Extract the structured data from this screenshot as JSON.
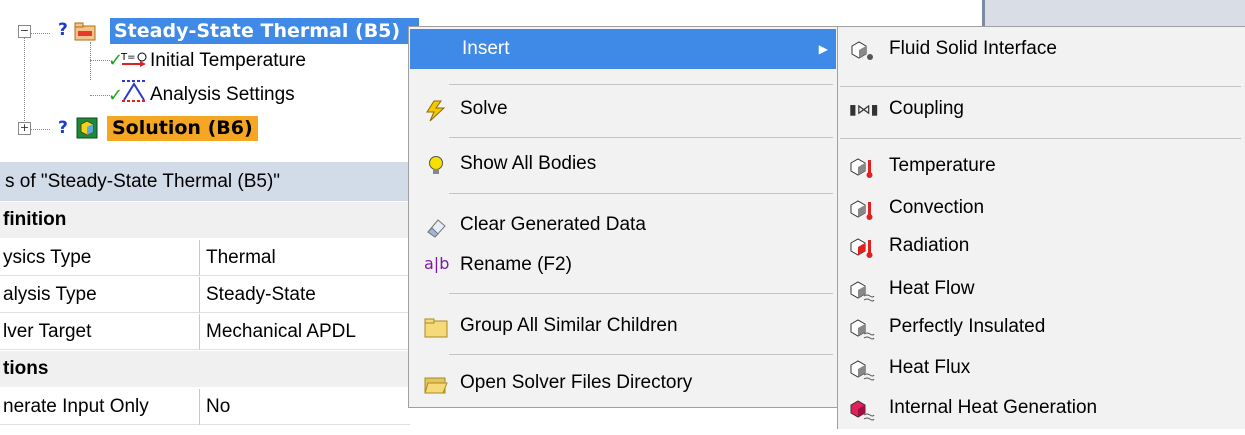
{
  "tree": {
    "analysis_label": "Steady-State Thermal (B5)",
    "children": [
      {
        "label": "Initial Temperature",
        "icon": "temperature-icon"
      },
      {
        "label": "Analysis Settings",
        "icon": "analysis-settings-icon"
      }
    ],
    "solution_label": "Solution (B6)"
  },
  "details": {
    "header": "s of \"Steady-State Thermal (B5)\"",
    "sections": [
      {
        "title": "finition",
        "rows": [
          {
            "name": "ysics Type",
            "value": "Thermal"
          },
          {
            "name": "alysis Type",
            "value": "Steady-State"
          },
          {
            "name": "lver Target",
            "value": "Mechanical APDL"
          }
        ]
      },
      {
        "title": "tions",
        "rows": [
          {
            "name": "nerate Input Only",
            "value": "No"
          }
        ]
      }
    ]
  },
  "context_menu": {
    "items": [
      {
        "label": "Insert",
        "icon": "none",
        "highlighted": true,
        "has_submenu": true
      },
      {
        "label": "Solve",
        "icon": "lightning-bolt-icon"
      },
      {
        "label": "Show All Bodies",
        "icon": "lightbulb-icon"
      },
      {
        "label": "Clear Generated Data",
        "icon": "eraser-icon"
      },
      {
        "label": "Rename (F2)",
        "icon": "rename-icon"
      },
      {
        "label": "Group All Similar Children",
        "icon": "folder-icon"
      },
      {
        "label": "Open Solver Files Directory",
        "icon": "open-folder-icon"
      }
    ]
  },
  "submenu": {
    "items": [
      {
        "label": "Fluid Solid Interface",
        "icon": "fluid-solid-interface-icon"
      },
      {
        "label": "Coupling",
        "icon": "coupling-icon"
      },
      {
        "label": "Temperature",
        "icon": "temperature-load-icon"
      },
      {
        "label": "Convection",
        "icon": "convection-icon"
      },
      {
        "label": "Radiation",
        "icon": "radiation-icon"
      },
      {
        "label": "Heat Flow",
        "icon": "heat-flow-icon"
      },
      {
        "label": "Perfectly Insulated",
        "icon": "perfectly-insulated-icon"
      },
      {
        "label": "Heat Flux",
        "icon": "heat-flux-icon"
      },
      {
        "label": "Internal Heat Generation",
        "icon": "internal-heat-generation-icon"
      }
    ]
  },
  "colors": {
    "selection": "#3f8ae6",
    "solution_highlight": "#f5a623",
    "details_header": "#d2dbe8",
    "check_green": "#21a321",
    "question_blue": "#1a3cc8"
  }
}
